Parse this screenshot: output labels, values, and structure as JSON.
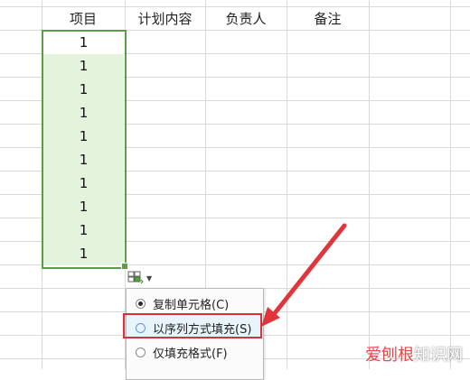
{
  "headers": [
    "项目",
    "计划内容",
    "负责人",
    "备注"
  ],
  "cells": [
    "1",
    "1",
    "1",
    "1",
    "1",
    "1",
    "1",
    "1",
    "1",
    "1"
  ],
  "autofill_menu": {
    "items": [
      {
        "label": "复制单元格(C)",
        "selected": true
      },
      {
        "label": "以序列方式填充(S)",
        "selected": false,
        "highlighted": true
      },
      {
        "label": "仅填充格式(F)",
        "selected": false
      }
    ]
  },
  "colors": {
    "selection_border": "#5d9c4a",
    "selection_fill": "#e4f3dc",
    "annotation_red": "#d7313b"
  },
  "watermark": {
    "brand": "爱刨根",
    "suffix": "知识网"
  }
}
